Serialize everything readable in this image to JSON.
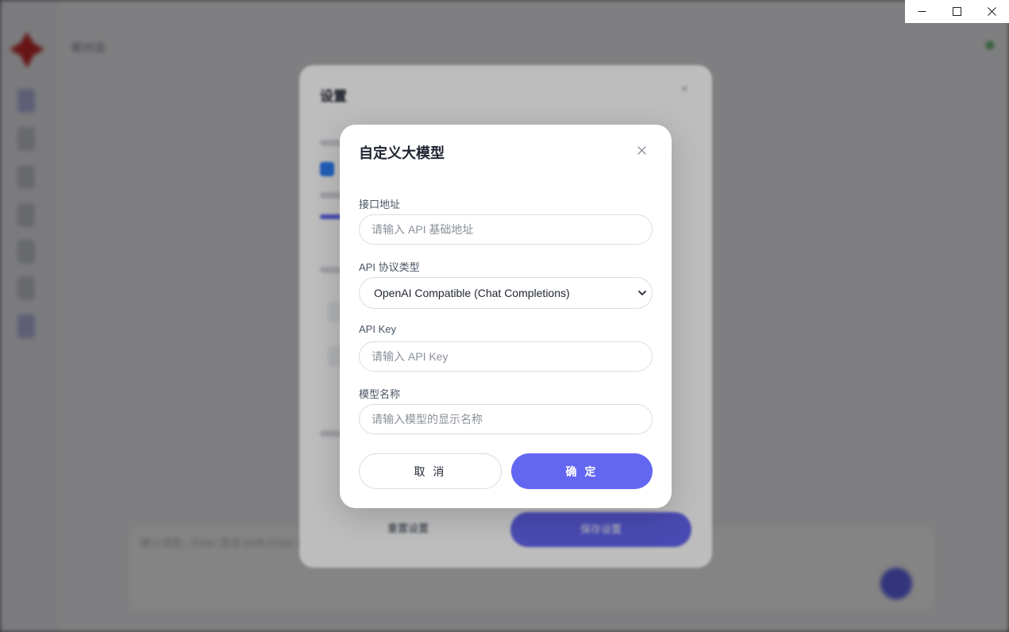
{
  "background_app": {
    "title": "新对话",
    "input_placeholder": "输入消息，Enter 发送 Shift+Enter 换行"
  },
  "settings_modal": {
    "title": "设置",
    "reset_label": "重置设置",
    "save_label": "保存设置"
  },
  "dialog": {
    "title": "自定义大模型",
    "fields": {
      "endpoint": {
        "label": "接口地址",
        "placeholder": "请输入 API 基础地址",
        "value": ""
      },
      "protocol": {
        "label": "API 协议类型",
        "selected": "OpenAI Compatible (Chat Completions)"
      },
      "api_key": {
        "label": "API Key",
        "placeholder": "请输入 API Key",
        "value": ""
      },
      "model_name": {
        "label": "模型名称",
        "placeholder": "请输入模型的显示名称",
        "value": ""
      }
    },
    "cancel_label": "取 消",
    "confirm_label": "确 定"
  },
  "colors": {
    "accent": "#6366f1",
    "backdrop": "#5d5e61",
    "dialog_bg": "#ffffff"
  },
  "icons": {
    "dialog_close": "close-icon",
    "select_arrow": "chevron-down-icon",
    "window_minimize": "minimize-icon",
    "window_maximize": "maximize-icon",
    "window_close": "close-icon"
  }
}
